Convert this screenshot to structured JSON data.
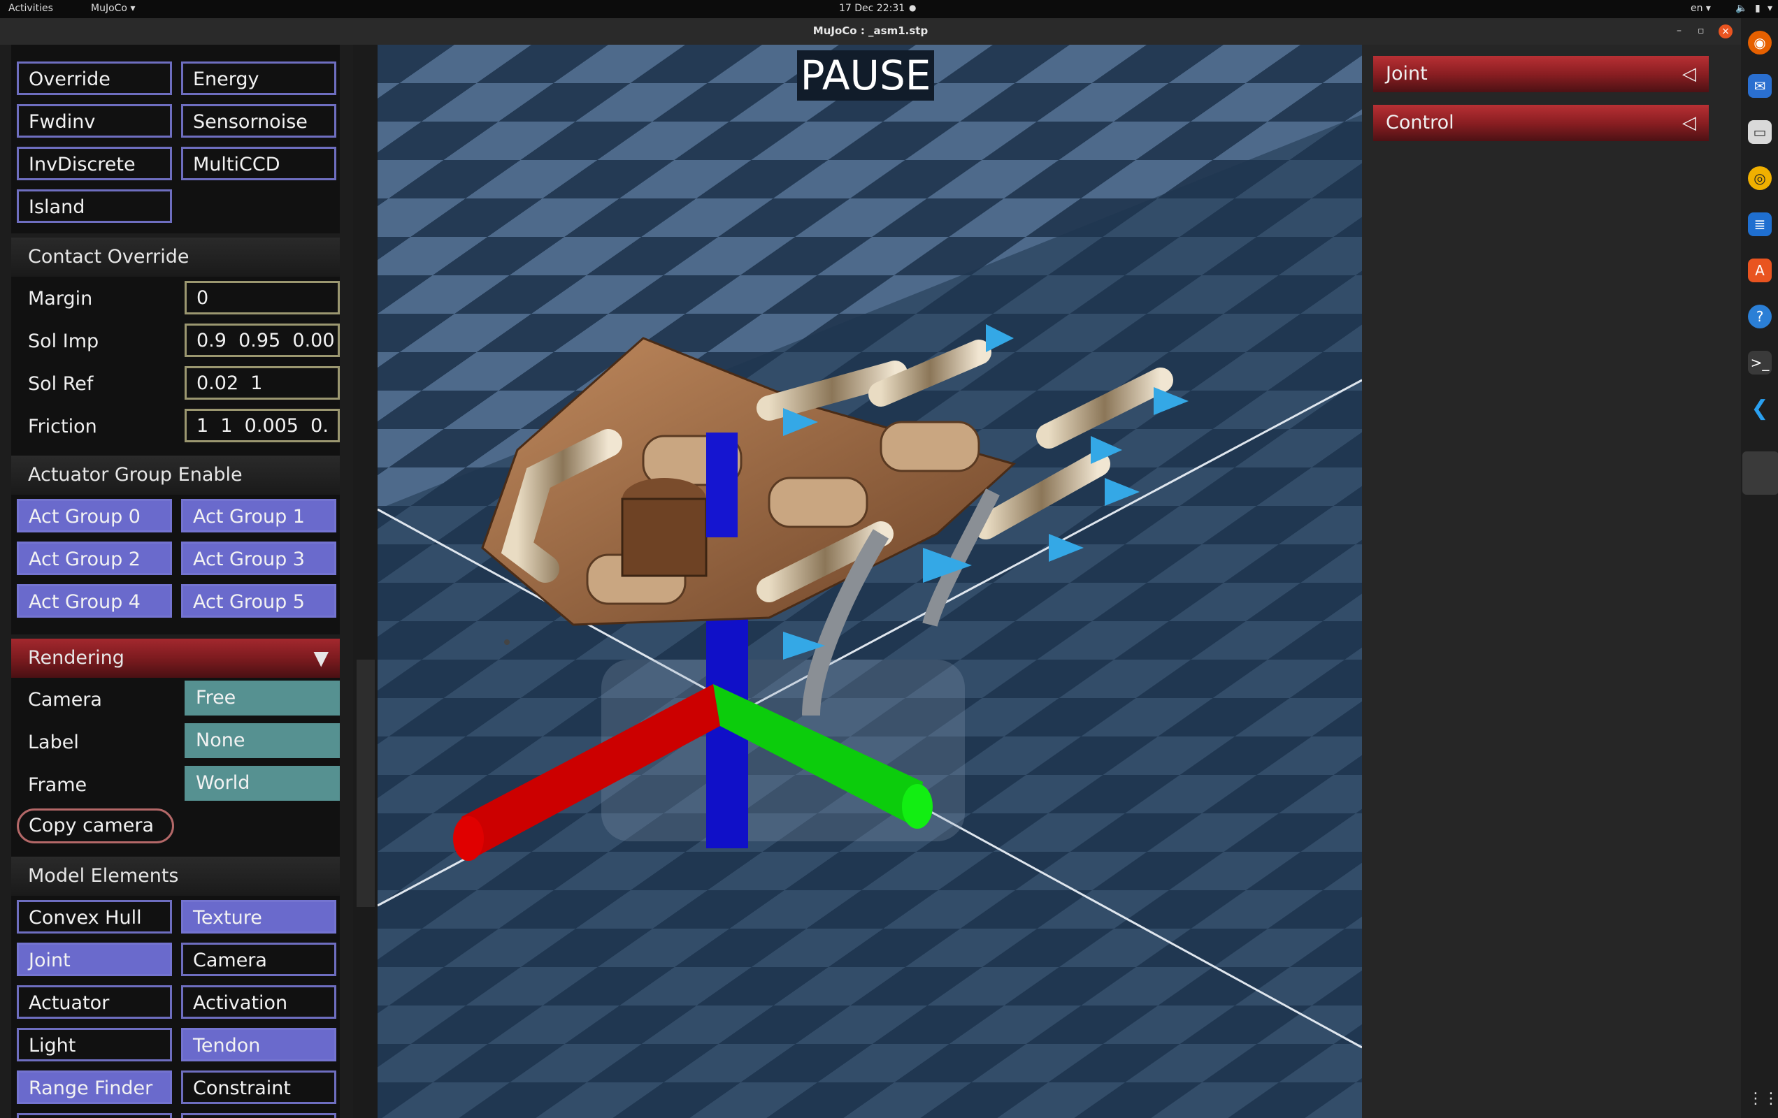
{
  "topbar": {
    "activities": "Activities",
    "app_menu": "MuJoCo ▾",
    "datetime": "17 Dec  22:31",
    "lang": "en ▾"
  },
  "window": {
    "title": "MuJoCo : _asm1.stp"
  },
  "flags": {
    "override": "Override",
    "energy": "Energy",
    "fwdinv": "Fwdinv",
    "sensornoise": "Sensornoise",
    "invdiscrete": "InvDiscrete",
    "multiccd": "MultiCCD",
    "island": "Island"
  },
  "contact_override": {
    "title": "Contact Override",
    "margin_label": "Margin",
    "margin_value": "0",
    "solimp_label": "Sol Imp",
    "solimp_value": "0.9  0.95  0.00",
    "solref_label": "Sol Ref",
    "solref_value": "0.02  1",
    "friction_label": "Friction",
    "friction_value": "1  1  0.005  0."
  },
  "actuator_groups": {
    "title": "Actuator Group Enable",
    "items": [
      "Act Group 0",
      "Act Group 1",
      "Act Group 2",
      "Act Group 3",
      "Act Group 4",
      "Act Group 5"
    ]
  },
  "rendering": {
    "title": "Rendering",
    "collapse_glyph": "▼",
    "camera_label": "Camera",
    "camera_value": "Free",
    "label_label": "Label",
    "label_value": "None",
    "frame_label": "Frame",
    "frame_value": "World",
    "copy_camera": "Copy camera"
  },
  "model_elements": {
    "title": "Model Elements",
    "items": [
      {
        "label": "Convex Hull",
        "on": false
      },
      {
        "label": "Texture",
        "on": true
      },
      {
        "label": "Joint",
        "on": true
      },
      {
        "label": "Camera",
        "on": false
      },
      {
        "label": "Actuator",
        "on": false
      },
      {
        "label": "Activation",
        "on": false
      },
      {
        "label": "Light",
        "on": false
      },
      {
        "label": "Tendon",
        "on": true
      },
      {
        "label": "Range Finder",
        "on": true
      },
      {
        "label": "Constraint",
        "on": false
      }
    ]
  },
  "viewport": {
    "status": "PAUSE"
  },
  "right": {
    "joint": "Joint",
    "control": "Control",
    "collapse_glyph": "◁"
  },
  "colors": {
    "enabled_button": "#6a6acc",
    "section_red": "#8a1e22",
    "select_teal": "#569191",
    "floor_blue": "#4f6b8c"
  }
}
